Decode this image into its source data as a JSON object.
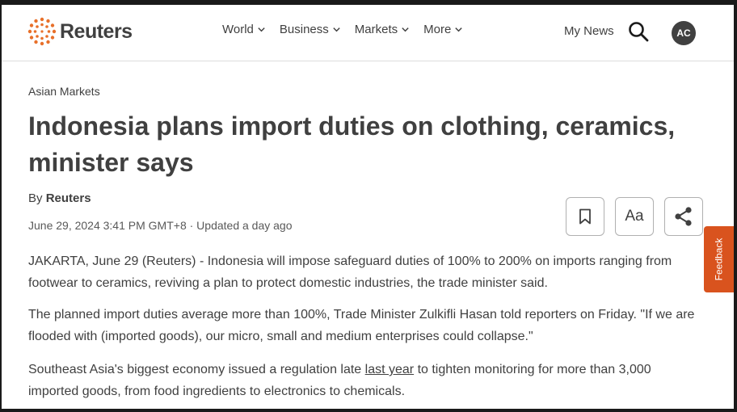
{
  "header": {
    "brand": "Reuters",
    "nav": [
      "World",
      "Business",
      "Markets",
      "More"
    ],
    "my_news": "My News",
    "avatar_initials": "AC"
  },
  "article": {
    "section": "Asian Markets",
    "headline": "Indonesia plans import duties on clothing, ceramics, minister says",
    "byline_prefix": "By",
    "byline_author": "Reuters",
    "dateline": "June 29, 2024 3:41 PM GMT+8 · Updated a day ago",
    "font_size_button": "Aa",
    "feedback_label": "Feedback",
    "paragraphs": [
      "JAKARTA, June 29 (Reuters) - Indonesia will impose safeguard duties of 100% to 200% on imports ranging from footwear to ceramics, reviving a plan to protect domestic industries, the trade minister said.",
      "The planned import duties average more than 100%, Trade Minister Zulkifli Hasan told reporters on Friday. \"If we are flooded with (imported goods), our micro, small and medium enterprises could collapse.\""
    ],
    "p3_before": "Southeast Asia's biggest economy issued a regulation late ",
    "p3_link": "last year",
    "p3_after": " to tighten monitoring for more than 3,000 imported goods, from food ingredients to electronics to chemicals."
  },
  "colors": {
    "text": "#404040",
    "logo_accent": "#e8702a",
    "feedback_bg": "#d9531e"
  }
}
